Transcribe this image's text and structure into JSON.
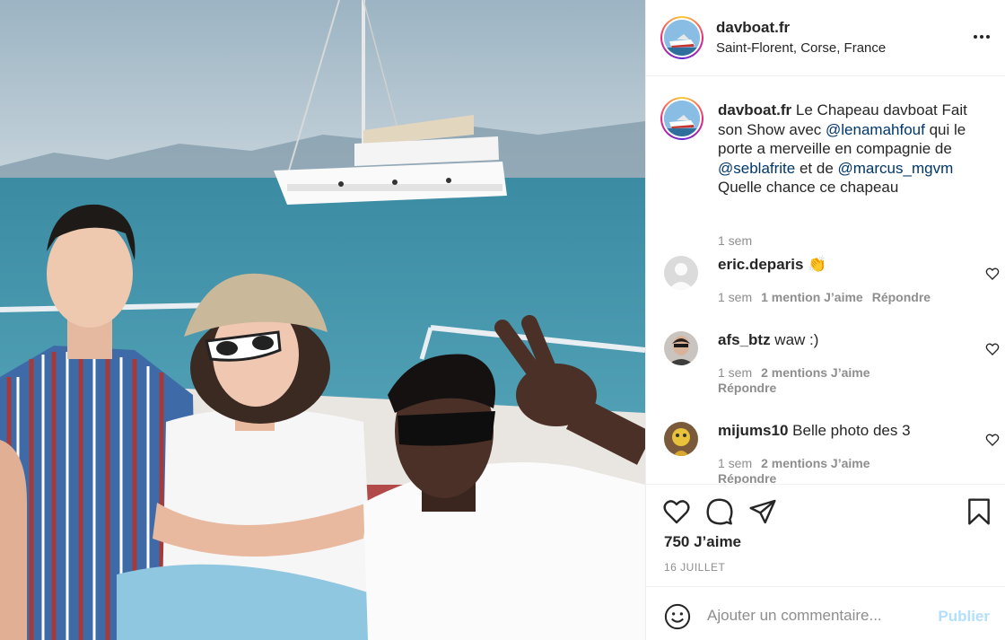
{
  "post": {
    "username": "davboat.fr",
    "location": "Saint-Florent, Corse, France",
    "caption": {
      "username": "davboat.fr",
      "text_1": " Le Chapeau davboat Fait son Show avec ",
      "mention_1": "@lenamahfouf",
      "text_2": " qui le porte a merveille en compagnie de ",
      "mention_2": "@seblafrite",
      "text_3": " et de ",
      "mention_3": "@marcus_mgvm",
      "text_4": " Quelle chance ce chapeau",
      "time": "1 sem"
    },
    "comments": [
      {
        "username": "eric.deparis",
        "text": " 👏",
        "time": "1 sem",
        "likes": "1 mention J’aime",
        "reply": "Répondre"
      },
      {
        "username": "afs_btz",
        "text": " waw :)",
        "time": "1 sem",
        "likes": "2 mentions J’aime",
        "reply": "Répondre"
      },
      {
        "username": "mijums10",
        "text": " Belle photo des 3",
        "time": "1 sem",
        "likes": "2 mentions J’aime",
        "reply": "Répondre"
      }
    ],
    "likes_count": "750 J’aime",
    "date": "16 JUILLET",
    "comment_placeholder": "Ajouter un commentaire...",
    "publish_label": "Publier"
  },
  "icons": {
    "more": "more-horizontal-icon",
    "like": "heart-icon",
    "comment": "comment-bubble-icon",
    "share": "paper-plane-icon",
    "save": "bookmark-icon",
    "emoji": "smiley-icon"
  },
  "colors": {
    "text": "#262626",
    "secondary": "#8e8e8e",
    "mention": "#00376b",
    "publish_disabled": "#b2dffc",
    "border": "#efefef"
  }
}
